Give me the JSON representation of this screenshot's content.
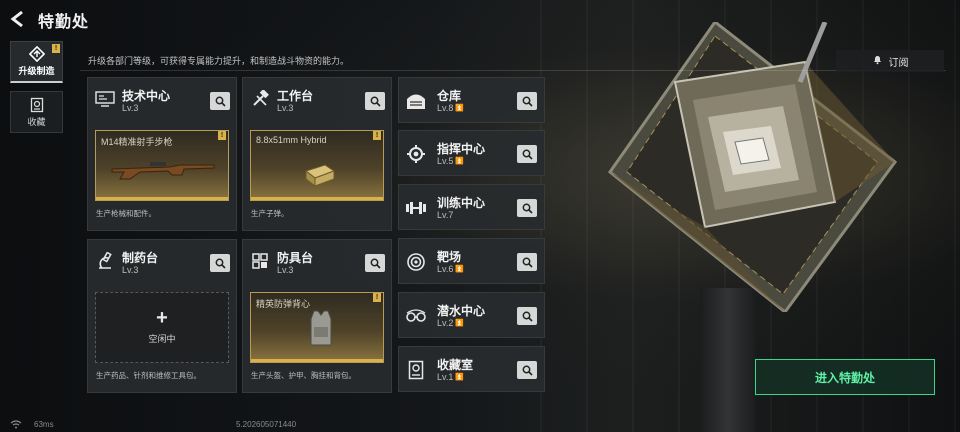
{
  "header": {
    "title": "特勤处"
  },
  "nav": [
    {
      "label": "升级制造",
      "badge": "!"
    },
    {
      "label": "收藏"
    }
  ],
  "description": "升级各部门等级，可获得专属能力提升，和制造战斗物资的能力。",
  "subscribe_label": "订阅",
  "enter_button": "进入特勤处",
  "cards_large": [
    {
      "name": "技术中心",
      "level": "Lv.3",
      "item": "M14精准射手步枪",
      "item_badge": "!",
      "footer": "生产枪械和配件。"
    },
    {
      "name": "工作台",
      "level": "Lv.3",
      "item": "8.8x51mm Hybrid",
      "item_badge": "!",
      "footer": "生产子弹。"
    },
    {
      "name": "制药台",
      "level": "Lv.3",
      "idle_label": "空闲中",
      "footer": "生产药品、针剂和维修工具包。"
    },
    {
      "name": "防具台",
      "level": "Lv.3",
      "item": "精英防弹背心",
      "item_badge": "!",
      "footer": "生产头盔、护甲、胸挂和背包。"
    }
  ],
  "cards_small": [
    {
      "name": "仓库",
      "level": "Lv.8",
      "upgrade": true
    },
    {
      "name": "指挥中心",
      "level": "Lv.5",
      "upgrade": true
    },
    {
      "name": "训练中心",
      "level": "Lv.7",
      "upgrade": false
    },
    {
      "name": "靶场",
      "level": "Lv.6",
      "upgrade": true
    },
    {
      "name": "潜水中心",
      "level": "Lv.2",
      "upgrade": true
    },
    {
      "name": "收藏室",
      "level": "Lv.1",
      "upgrade": true
    }
  ],
  "footer": {
    "ping": "63ms",
    "build_id": "5.202605071440"
  },
  "colors": {
    "accent_green": "#3bd68a",
    "gold": "#d9b24a"
  }
}
